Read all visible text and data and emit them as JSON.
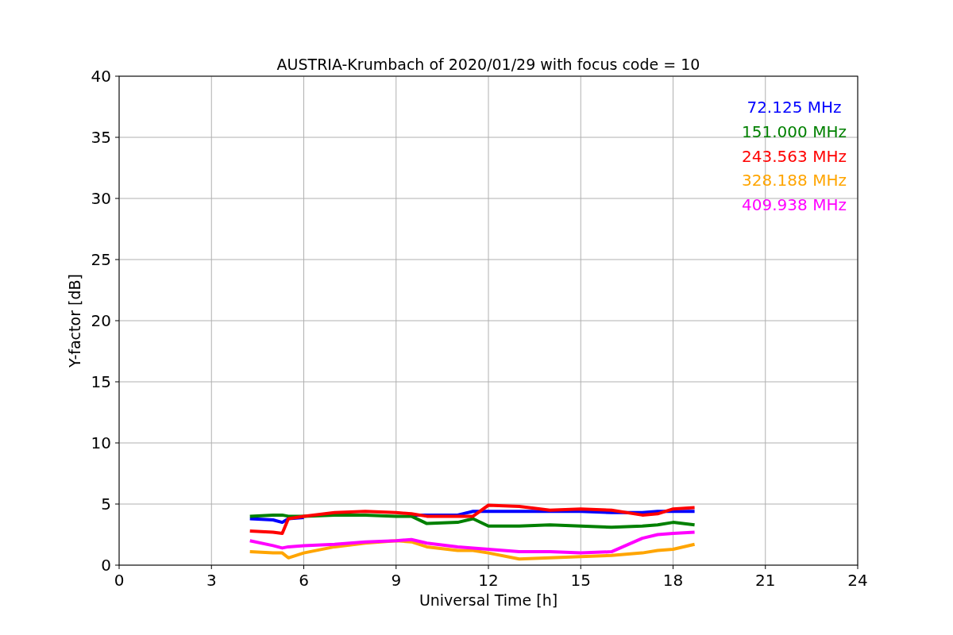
{
  "chart_data": {
    "type": "line",
    "title": "AUSTRIA-Krumbach of 2020/01/29 with focus code = 10",
    "xlabel": "Universal Time [h]",
    "ylabel": "Y-factor [dB]",
    "x": [
      4.25,
      5,
      5.3,
      5.5,
      6,
      7,
      8,
      9,
      9.5,
      10,
      11,
      11.5,
      12,
      13,
      14,
      15,
      16,
      17,
      17.5,
      18,
      18.7
    ],
    "xlim": [
      0,
      24
    ],
    "ylim": [
      0,
      40
    ],
    "xticks": [
      0,
      3,
      6,
      9,
      12,
      15,
      18,
      21,
      24
    ],
    "yticks": [
      0,
      5,
      10,
      15,
      20,
      25,
      30,
      35,
      40
    ],
    "grid": true,
    "series": [
      {
        "name": "72.125 MHz",
        "color": "#0000ff",
        "values": [
          3.8,
          3.7,
          3.5,
          3.8,
          3.9,
          null,
          null,
          null,
          4.1,
          4.1,
          4.1,
          4.4,
          4.4,
          4.4,
          4.4,
          4.4,
          4.3,
          4.3,
          4.4,
          4.4,
          4.4
        ]
      },
      {
        "name": "151.000 MHz",
        "color": "#008000",
        "values": [
          4.0,
          4.1,
          4.1,
          4.0,
          4.0,
          4.1,
          4.1,
          4.0,
          4.0,
          3.4,
          3.5,
          3.8,
          3.2,
          3.2,
          3.3,
          3.2,
          3.1,
          3.2,
          3.3,
          3.5,
          3.3
        ]
      },
      {
        "name": "243.563 MHz",
        "color": "#ff0000",
        "values": [
          2.8,
          2.7,
          2.6,
          3.8,
          4.0,
          4.3,
          4.4,
          4.3,
          4.2,
          4.0,
          4.0,
          4.0,
          4.9,
          4.8,
          4.5,
          4.6,
          4.5,
          4.1,
          4.2,
          4.6,
          4.7
        ]
      },
      {
        "name": "328.188 MHz",
        "color": "#ffa500",
        "values": [
          1.1,
          1.0,
          1.0,
          0.6,
          1.0,
          1.5,
          1.8,
          2.0,
          1.9,
          1.5,
          1.2,
          1.2,
          1.0,
          0.5,
          0.6,
          0.7,
          0.8,
          1.0,
          1.2,
          1.3,
          1.7
        ]
      },
      {
        "name": "409.938 MHz",
        "color": "#ff00ff",
        "values": [
          2.0,
          1.6,
          1.4,
          1.5,
          1.6,
          1.7,
          1.9,
          2.0,
          2.1,
          1.8,
          1.5,
          1.4,
          1.3,
          1.1,
          1.1,
          1.0,
          1.1,
          2.2,
          2.5,
          2.6,
          2.7
        ]
      }
    ]
  }
}
